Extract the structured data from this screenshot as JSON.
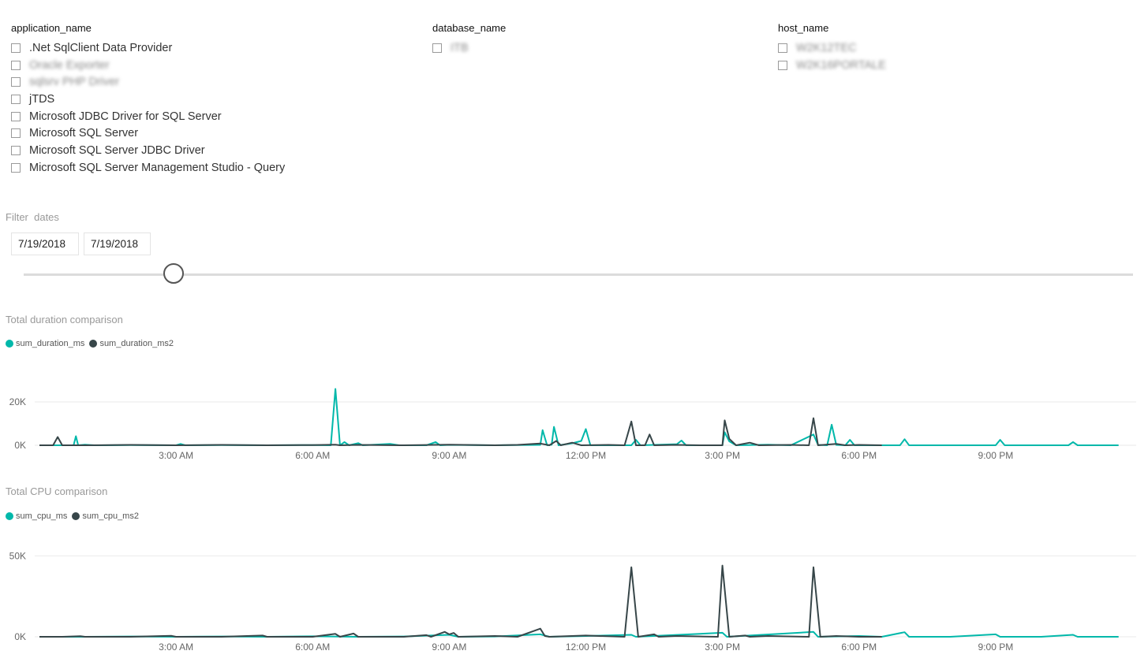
{
  "slicers": {
    "application_name": {
      "title": "application_name",
      "items": [
        ".Net SqlClient Data Provider",
        "Oracle Exporter",
        "sqlsrv PHP Driver",
        "jTDS",
        "Microsoft JDBC Driver for SQL Server",
        "Microsoft SQL Server",
        "Microsoft SQL Server JDBC Driver",
        "Microsoft SQL Server Management Studio - Query"
      ]
    },
    "database_name": {
      "title": "database_name",
      "items": [
        "ITB"
      ]
    },
    "host_name": {
      "title": "host_name",
      "items": [
        "W2K12TEC",
        "W2K16PORTALE"
      ]
    }
  },
  "filter": {
    "title": "Filter  dates",
    "start_date": "7/19/2018",
    "end_date": "7/19/2018",
    "slider_position": 0.135
  },
  "colors": {
    "series1": "#01B8AA",
    "series2": "#374649",
    "gridline": "#eaeaea"
  },
  "chart_data": [
    {
      "type": "line",
      "title": "Total duration comparison",
      "x_unit": "hours since 12:00 AM",
      "x_range": [
        0,
        24
      ],
      "ylim": [
        0,
        28000
      ],
      "y_ticks": [
        0,
        20000
      ],
      "y_tick_labels": [
        "0K",
        "20K"
      ],
      "x_ticks": [
        3,
        6,
        9,
        12,
        15,
        18,
        21
      ],
      "x_tick_labels": [
        "3:00 AM",
        "6:00 AM",
        "9:00 AM",
        "12:00 PM",
        "3:00 PM",
        "6:00 PM",
        "9:00 PM"
      ],
      "series": [
        {
          "name": "sum_duration_ms",
          "color": "#01B8AA",
          "points": [
            [
              0,
              0
            ],
            [
              0.6,
              0
            ],
            [
              0.75,
              0
            ],
            [
              0.8,
              4200
            ],
            [
              0.85,
              0
            ],
            [
              1.0,
              300
            ],
            [
              1.2,
              0
            ],
            [
              2.0,
              100
            ],
            [
              3.0,
              0
            ],
            [
              3.1,
              600
            ],
            [
              3.2,
              0
            ],
            [
              4.0,
              100
            ],
            [
              5.0,
              0
            ],
            [
              6.0,
              100
            ],
            [
              6.4,
              0
            ],
            [
              6.5,
              26000
            ],
            [
              6.6,
              0
            ],
            [
              6.7,
              1500
            ],
            [
              6.8,
              0
            ],
            [
              7.0,
              1000
            ],
            [
              7.1,
              0
            ],
            [
              7.7,
              600
            ],
            [
              7.9,
              0
            ],
            [
              8.5,
              0
            ],
            [
              8.7,
              1500
            ],
            [
              8.8,
              0
            ],
            [
              9.0,
              200
            ],
            [
              10.0,
              0
            ],
            [
              11.0,
              200
            ],
            [
              11.05,
              7000
            ],
            [
              11.15,
              0
            ],
            [
              11.25,
              300
            ],
            [
              11.3,
              8500
            ],
            [
              11.4,
              0
            ],
            [
              11.7,
              900
            ],
            [
              11.9,
              2000
            ],
            [
              12.0,
              7500
            ],
            [
              12.1,
              0
            ],
            [
              12.5,
              0
            ],
            [
              13.0,
              0
            ],
            [
              13.1,
              2500
            ],
            [
              13.2,
              0
            ],
            [
              14.0,
              500
            ],
            [
              14.1,
              2200
            ],
            [
              14.2,
              0
            ],
            [
              15.0,
              0
            ],
            [
              15.05,
              6000
            ],
            [
              15.15,
              1800
            ],
            [
              15.3,
              0
            ],
            [
              16.0,
              300
            ],
            [
              16.5,
              0
            ],
            [
              17.0,
              5000
            ],
            [
              17.1,
              200
            ],
            [
              17.3,
              0
            ],
            [
              17.4,
              9500
            ],
            [
              17.5,
              200
            ],
            [
              17.7,
              0
            ],
            [
              17.8,
              2500
            ],
            [
              17.9,
              0
            ],
            [
              18.5,
              0
            ],
            [
              18.9,
              0
            ],
            [
              19.0,
              2800
            ],
            [
              19.1,
              0
            ],
            [
              20.0,
              0
            ],
            [
              21.0,
              0
            ],
            [
              21.1,
              2500
            ],
            [
              21.2,
              0
            ],
            [
              22.0,
              0
            ],
            [
              22.6,
              0
            ],
            [
              22.7,
              1500
            ],
            [
              22.8,
              0
            ],
            [
              23.5,
              0
            ],
            [
              23.7,
              0
            ]
          ]
        },
        {
          "name": "sum_duration_ms2",
          "color": "#374649",
          "points": [
            [
              0,
              0
            ],
            [
              0.3,
              0
            ],
            [
              0.4,
              3800
            ],
            [
              0.5,
              0
            ],
            [
              1.0,
              0
            ],
            [
              2.0,
              200
            ],
            [
              3.0,
              0
            ],
            [
              4.0,
              200
            ],
            [
              5.0,
              0
            ],
            [
              6.0,
              100
            ],
            [
              6.5,
              300
            ],
            [
              6.6,
              0
            ],
            [
              7.0,
              200
            ],
            [
              8.0,
              0
            ],
            [
              9.0,
              300
            ],
            [
              10.0,
              0
            ],
            [
              10.5,
              200
            ],
            [
              11.0,
              800
            ],
            [
              11.2,
              0
            ],
            [
              11.35,
              2000
            ],
            [
              11.45,
              0
            ],
            [
              11.7,
              1200
            ],
            [
              11.9,
              0
            ],
            [
              12.5,
              200
            ],
            [
              12.85,
              0
            ],
            [
              13.0,
              11000
            ],
            [
              13.1,
              0
            ],
            [
              13.3,
              0
            ],
            [
              13.4,
              5000
            ],
            [
              13.5,
              0
            ],
            [
              14.0,
              200
            ],
            [
              14.5,
              0
            ],
            [
              15.0,
              0
            ],
            [
              15.05,
              11500
            ],
            [
              15.15,
              3000
            ],
            [
              15.3,
              0
            ],
            [
              15.6,
              1200
            ],
            [
              15.8,
              0
            ],
            [
              16.5,
              200
            ],
            [
              16.9,
              0
            ],
            [
              17.0,
              12500
            ],
            [
              17.1,
              0
            ],
            [
              17.5,
              600
            ],
            [
              17.7,
              0
            ],
            [
              18.0,
              200
            ],
            [
              18.5,
              0
            ]
          ]
        }
      ]
    },
    {
      "type": "line",
      "title": "Total CPU comparison",
      "x_unit": "hours since 12:00 AM",
      "x_range": [
        0,
        24
      ],
      "ylim": [
        0,
        55000
      ],
      "y_ticks": [
        0,
        50000
      ],
      "y_tick_labels": [
        "0K",
        "50K"
      ],
      "x_ticks": [
        3,
        6,
        9,
        12,
        15,
        18,
        21
      ],
      "x_tick_labels": [
        "3:00 AM",
        "6:00 AM",
        "9:00 AM",
        "12:00 PM",
        "3:00 PM",
        "6:00 PM",
        "9:00 PM"
      ],
      "series": [
        {
          "name": "sum_cpu_ms",
          "color": "#01B8AA",
          "points": [
            [
              0,
              0
            ],
            [
              1,
              0
            ],
            [
              2,
              200
            ],
            [
              3,
              0
            ],
            [
              4,
              200
            ],
            [
              5,
              0
            ],
            [
              6,
              300
            ],
            [
              7,
              0
            ],
            [
              8,
              200
            ],
            [
              9,
              1200
            ],
            [
              9.2,
              0
            ],
            [
              10,
              200
            ],
            [
              11,
              1500
            ],
            [
              11.2,
              0
            ],
            [
              12,
              500
            ],
            [
              13,
              1200
            ],
            [
              13.1,
              0
            ],
            [
              15,
              2500
            ],
            [
              15.1,
              0
            ],
            [
              17,
              3000
            ],
            [
              17.1,
              0
            ],
            [
              18,
              500
            ],
            [
              18.5,
              0
            ],
            [
              19,
              2800
            ],
            [
              19.1,
              0
            ],
            [
              20,
              0
            ],
            [
              21,
              1500
            ],
            [
              21.1,
              0
            ],
            [
              22,
              0
            ],
            [
              22.7,
              1200
            ],
            [
              22.8,
              0
            ],
            [
              23.7,
              0
            ]
          ]
        },
        {
          "name": "sum_cpu_ms2",
          "color": "#374649",
          "points": [
            [
              0,
              0
            ],
            [
              0.5,
              0
            ],
            [
              0.9,
              400
            ],
            [
              1.0,
              0
            ],
            [
              2.0,
              0
            ],
            [
              2.9,
              600
            ],
            [
              3.0,
              0
            ],
            [
              4.0,
              0
            ],
            [
              4.9,
              800
            ],
            [
              5.0,
              0
            ],
            [
              6.0,
              0
            ],
            [
              6.5,
              1800
            ],
            [
              6.6,
              0
            ],
            [
              6.9,
              2000
            ],
            [
              7.0,
              0
            ],
            [
              8.0,
              0
            ],
            [
              8.5,
              1000
            ],
            [
              8.6,
              0
            ],
            [
              8.9,
              3000
            ],
            [
              9.0,
              1500
            ],
            [
              9.1,
              2400
            ],
            [
              9.2,
              0
            ],
            [
              10.0,
              500
            ],
            [
              10.5,
              0
            ],
            [
              11.0,
              5000
            ],
            [
              11.1,
              500
            ],
            [
              11.2,
              0
            ],
            [
              12.0,
              800
            ],
            [
              12.85,
              0
            ],
            [
              13.0,
              43000
            ],
            [
              13.15,
              0
            ],
            [
              13.5,
              1500
            ],
            [
              13.6,
              0
            ],
            [
              14.0,
              500
            ],
            [
              14.9,
              0
            ],
            [
              15.0,
              44000
            ],
            [
              15.15,
              0
            ],
            [
              15.5,
              800
            ],
            [
              15.6,
              0
            ],
            [
              16.0,
              500
            ],
            [
              16.9,
              0
            ],
            [
              17.0,
              43000
            ],
            [
              17.15,
              0
            ],
            [
              17.5,
              500
            ],
            [
              18.0,
              0
            ],
            [
              18.5,
              0
            ]
          ]
        }
      ]
    }
  ]
}
